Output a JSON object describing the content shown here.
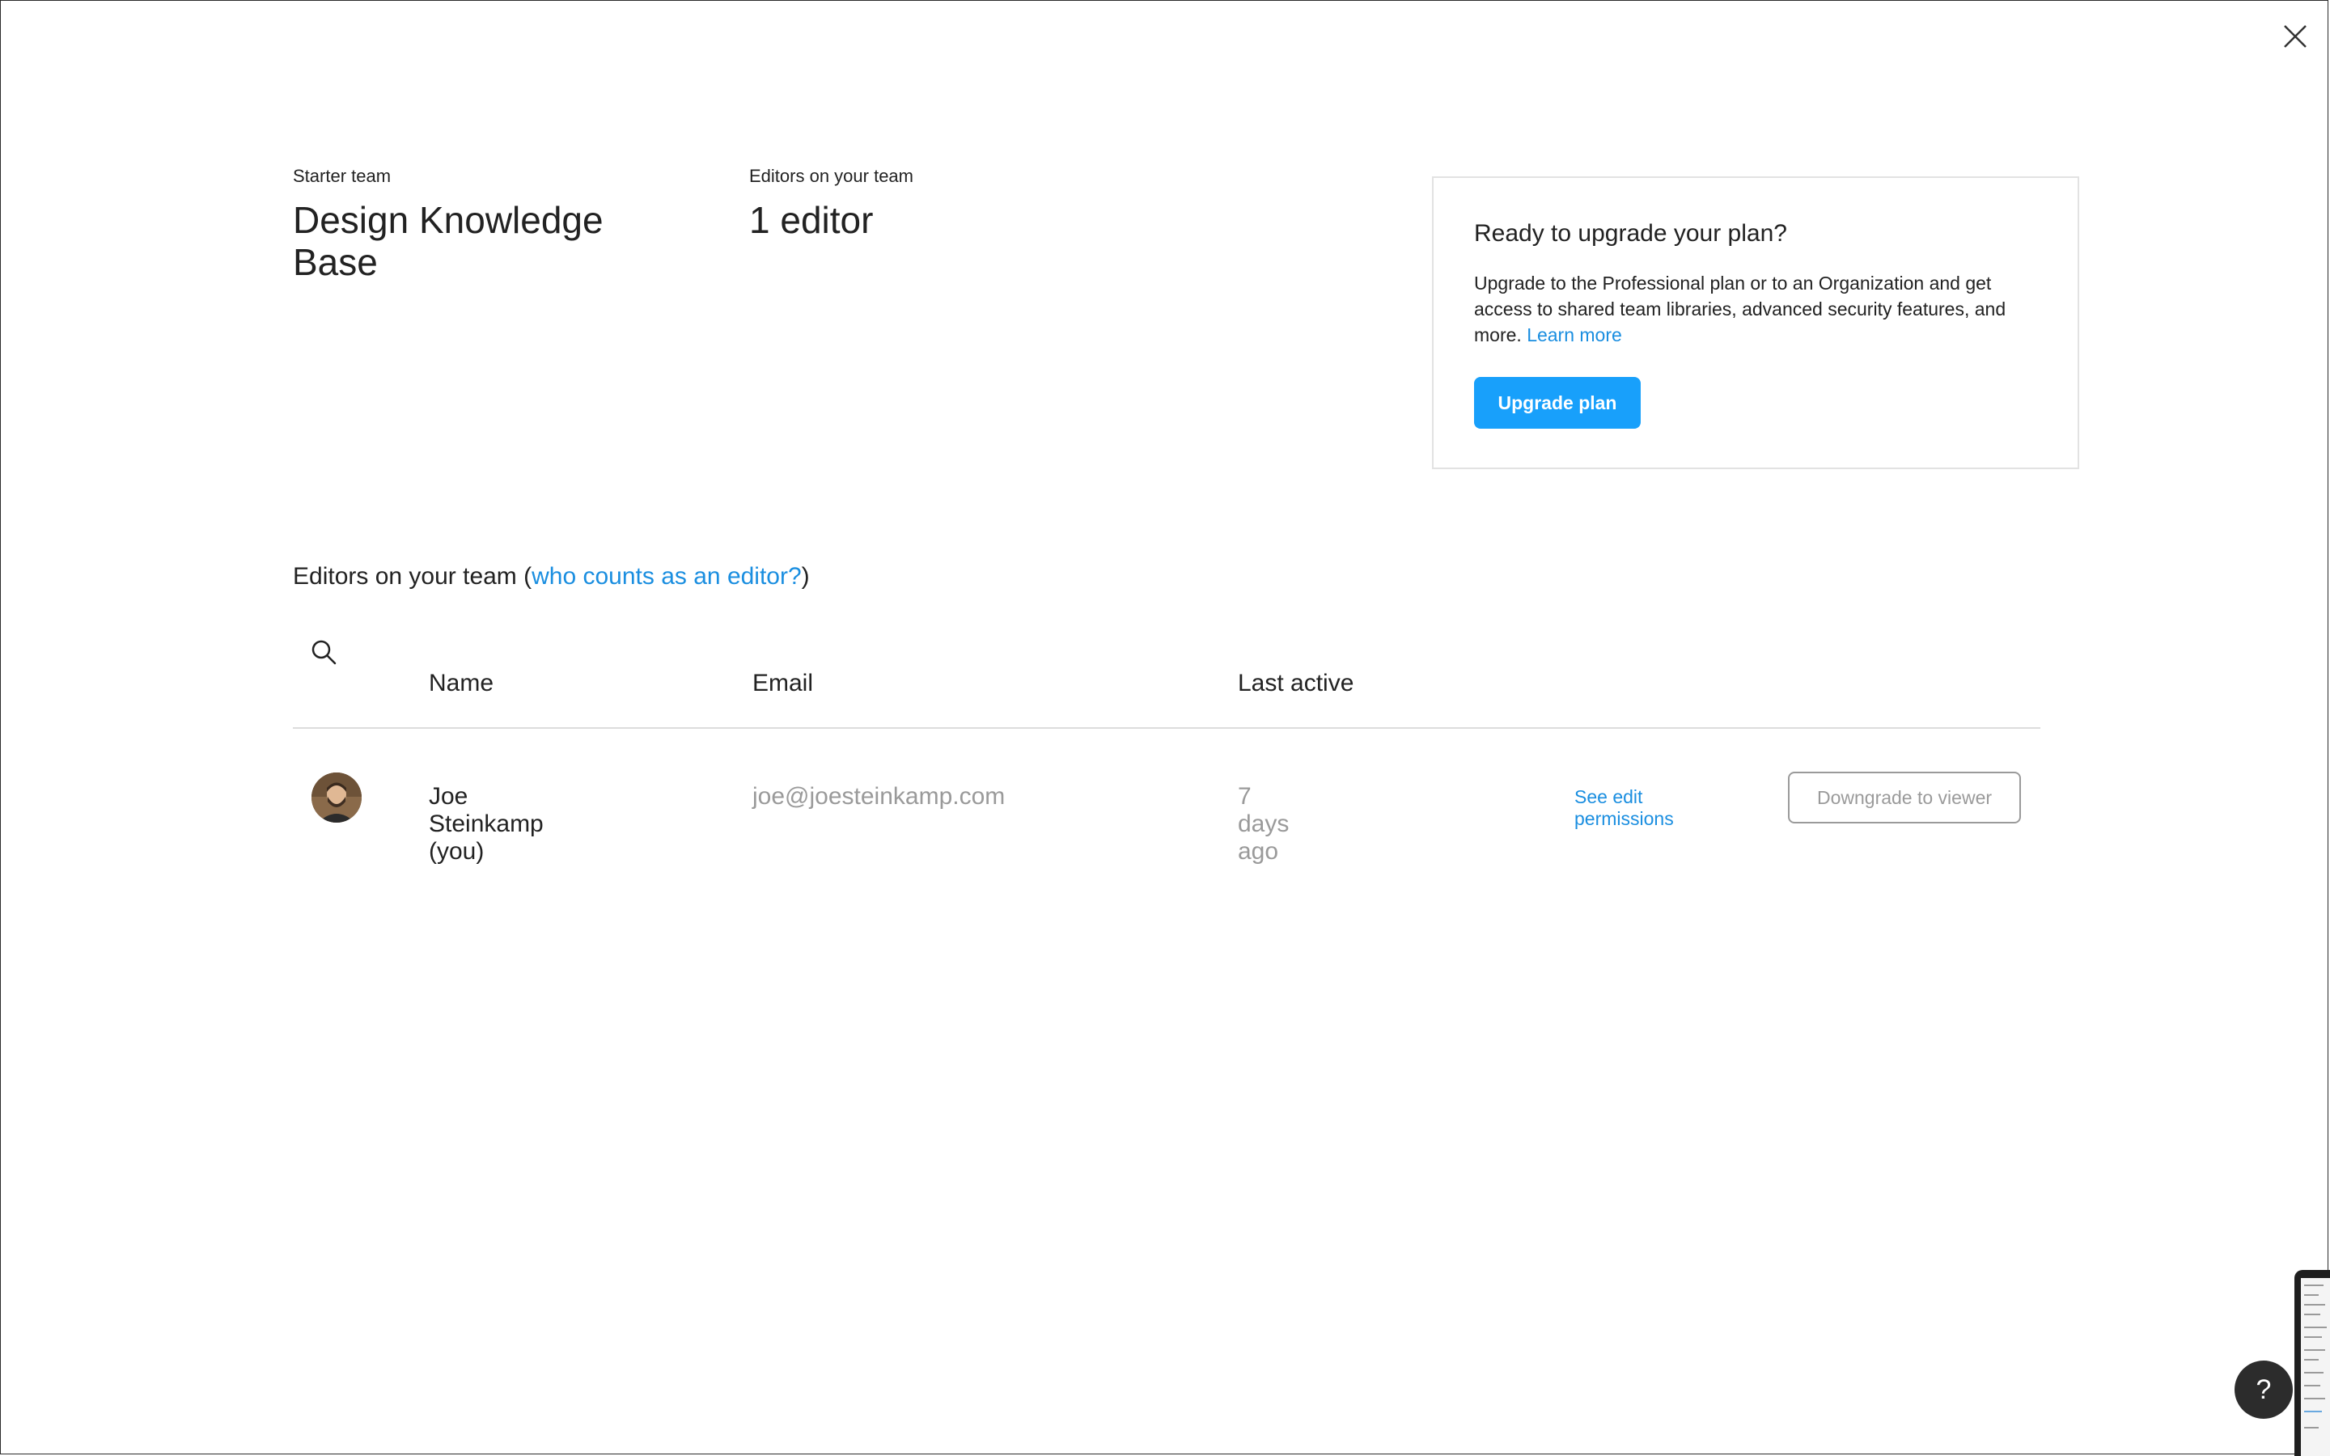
{
  "header": {
    "team_label": "Starter team",
    "team_name": "Design Knowledge Base",
    "editors_label": "Editors on your team",
    "editor_count": "1 editor"
  },
  "upgrade": {
    "title": "Ready to upgrade your plan?",
    "description": "Upgrade to the Professional plan or to an Organization and get access to shared team libraries, advanced security features, and more.",
    "learn_more": "Learn more",
    "button": "Upgrade plan"
  },
  "section": {
    "title_prefix": "Editors on your team (",
    "title_link": "who counts as an editor?",
    "title_suffix": ")"
  },
  "table": {
    "columns": {
      "name": "Name",
      "email": "Email",
      "last_active": "Last active"
    },
    "rows": [
      {
        "name": "Joe Steinkamp (you)",
        "email": "joe@joesteinkamp.com",
        "last_active": "7 days ago",
        "permissions_link": "See edit permissions",
        "downgrade_button": "Downgrade to viewer"
      }
    ]
  },
  "help": {
    "label": "?"
  },
  "icons": {
    "close": "close-icon",
    "search": "search-icon",
    "help": "help-icon"
  },
  "colors": {
    "accent": "#18a0fb",
    "link": "#1a8ee0",
    "muted_text": "#9a9a9a",
    "help_bg": "#2c2c2c"
  }
}
